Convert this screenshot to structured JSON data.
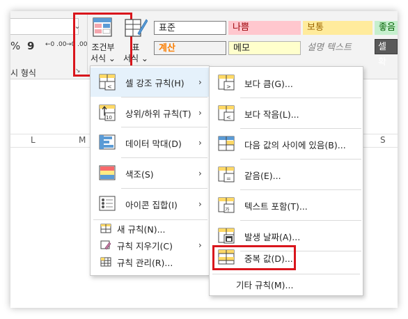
{
  "ribbon": {
    "number_group_label": "표시 형식",
    "number_group_label_clipped": "시 형식",
    "number_symbols": [
      "%",
      "9"
    ],
    "decimal_increase": "←0 .00",
    "decimal_decrease": "→0 .00",
    "conditional_format_label": [
      "조건부",
      "서식 ⌄"
    ],
    "table_format_label": [
      "표",
      "서식 ⌄"
    ],
    "styles": [
      {
        "label": "표준",
        "bg": "#ffffff",
        "fg": "#222222"
      },
      {
        "label": "나쁨",
        "bg": "#ffc7ce",
        "fg": "#9c0006"
      },
      {
        "label": "보통",
        "bg": "#ffeb9c",
        "fg": "#9c6500"
      },
      {
        "label": "좋음",
        "bg": "#c6efce",
        "fg": "#006100"
      },
      {
        "label": "계산",
        "bg": "#f2f2f2",
        "fg": "#fa7d00"
      },
      {
        "label": "메모",
        "bg": "#ffffcc",
        "fg": "#222222"
      },
      {
        "label": "설명 텍스트",
        "bg": "#f3f3f3",
        "fg": "#7f7f7f"
      },
      {
        "label": "셀 확",
        "bg": "#595959",
        "fg": "#ffffff"
      }
    ]
  },
  "sheet": {
    "columns": [
      "L",
      "M",
      "S"
    ]
  },
  "main_menu": {
    "items": [
      {
        "label": "셀 강조 규칙(H)",
        "has_submenu": true
      },
      {
        "label": "상위/하위 규칙(T)",
        "has_submenu": true
      },
      {
        "label": "데이터 막대(D)",
        "has_submenu": true
      },
      {
        "label": "색조(S)",
        "has_submenu": true
      },
      {
        "label": "아이콘 집합(I)",
        "has_submenu": true
      }
    ],
    "small_items": [
      {
        "label": "새 규칙(N)...",
        "has_submenu": false
      },
      {
        "label": "규칙 지우기(C)",
        "has_submenu": true
      },
      {
        "label": "규칙 관리(R)...",
        "has_submenu": false
      }
    ]
  },
  "sub_menu": {
    "items": [
      {
        "label": "보다 큼(G)...",
        "icon": "greater-than-icon"
      },
      {
        "label": "보다 작음(L)...",
        "icon": "less-than-icon"
      },
      {
        "label": "다음 값의 사이에 있음(B)...",
        "icon": "between-icon"
      },
      {
        "label": "같음(E)...",
        "icon": "equal-to-icon"
      },
      {
        "label": "텍스트 포함(T)...",
        "icon": "text-contains-icon"
      },
      {
        "label": "발생 날짜(A)...",
        "icon": "date-occurring-icon"
      },
      {
        "label": "중복 값(D)...",
        "icon": "duplicate-values-icon"
      }
    ],
    "more_rules": "기타 규칙(M)..."
  },
  "arrow_glyph": "›"
}
